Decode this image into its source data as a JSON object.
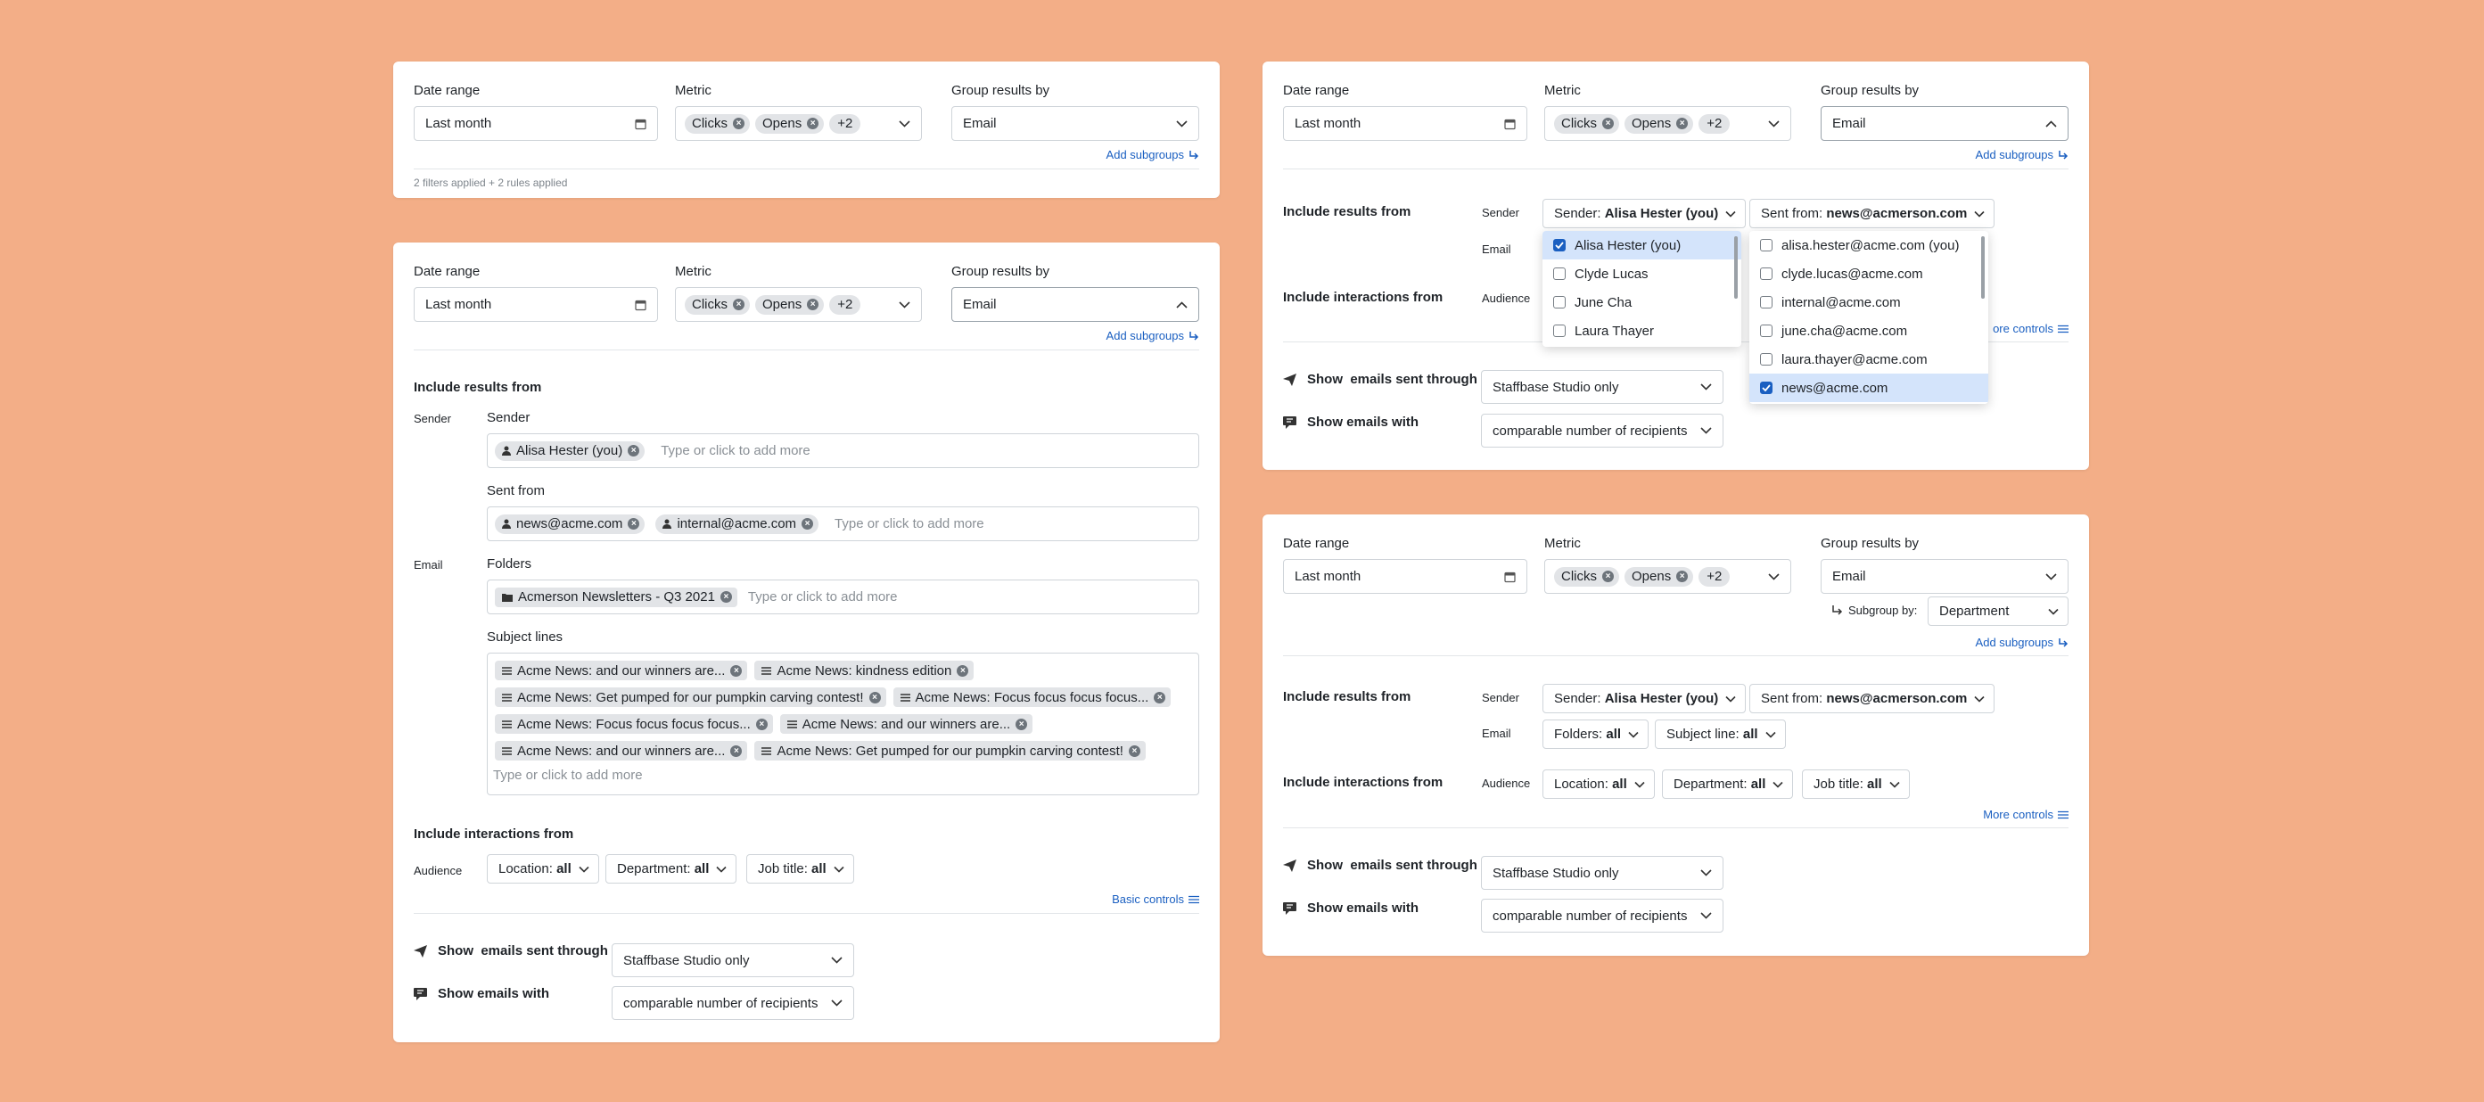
{
  "labels": {
    "date_range": "Date range",
    "metric": "Metric",
    "group_by": "Group results by",
    "include_results": "Include results from",
    "include_interactions": "Include interactions from",
    "sender": "Sender",
    "email": "Email",
    "audience": "Audience",
    "sent_from": "Sent from",
    "folders": "Folders",
    "subject_lines": "Subject lines",
    "show": "Show",
    "emails_sent_through": "emails sent through",
    "show_emails_with": "Show emails with",
    "subgroup_by": "Subgroup by:"
  },
  "values": {
    "date_range": "Last month",
    "group_by": "Email",
    "subgroup": "Department",
    "send_tool": "Staffbase Studio only",
    "emails_with": "comparable number of recipients"
  },
  "metric_chips": [
    "Clicks",
    "Opens"
  ],
  "metric_more": "+2",
  "links": {
    "add_subgroups": "Add subgroups",
    "more_controls": "More controls",
    "basic_controls": "Basic controls",
    "more_controls_clipped": "ore controls"
  },
  "footer": "2 filters applied + 2 rules applied",
  "placeholder_add": "Type or click to add more",
  "sender_chips": [
    "Alisa Hester (you)"
  ],
  "sent_from_chips": [
    "news@acme.com",
    "internal@acme.com"
  ],
  "folder_chips": [
    "Acmerson Newsletters - Q3 2021"
  ],
  "subject_chips": [
    "Acme News: and our winners are...",
    "Acme News: kindness edition",
    "Acme News: Get pumped for our pumpkin carving contest!",
    "Acme News: Focus focus focus focus...",
    "Acme News: Focus focus focus focus...",
    "Acme News: and our winners are...",
    "Acme News: and our winners are...",
    "Acme News: Get pumped for our pumpkin carving contest!"
  ],
  "filters": {
    "sender_prefix": "Sender:",
    "sender_value": "Alisa Hester (you)",
    "sent_from_prefix": "Sent from:",
    "sent_from_value": "news@acmerson.com",
    "folders_prefix": "Folders:",
    "subject_prefix": "Subject line:",
    "location_prefix": "Location:",
    "department_prefix": "Department:",
    "job_prefix": "Job title:",
    "all": "all"
  },
  "sender_options": [
    {
      "label": "Alisa Hester (you)",
      "checked": true
    },
    {
      "label": "Clyde Lucas",
      "checked": false
    },
    {
      "label": "June Cha",
      "checked": false
    },
    {
      "label": "Laura Thayer",
      "checked": false
    }
  ],
  "sent_from_options": [
    {
      "label": "alisa.hester@acme.com (you)",
      "checked": false
    },
    {
      "label": "clyde.lucas@acme.com",
      "checked": false
    },
    {
      "label": "internal@acme.com",
      "checked": false
    },
    {
      "label": "june.cha@acme.com",
      "checked": false
    },
    {
      "label": "laura.thayer@acme.com",
      "checked": false
    },
    {
      "label": "news@acme.com",
      "checked": true
    }
  ],
  "colors": {
    "background": "#f3ae87",
    "link": "#1a5fc1",
    "selected": "#d4e4fb"
  }
}
